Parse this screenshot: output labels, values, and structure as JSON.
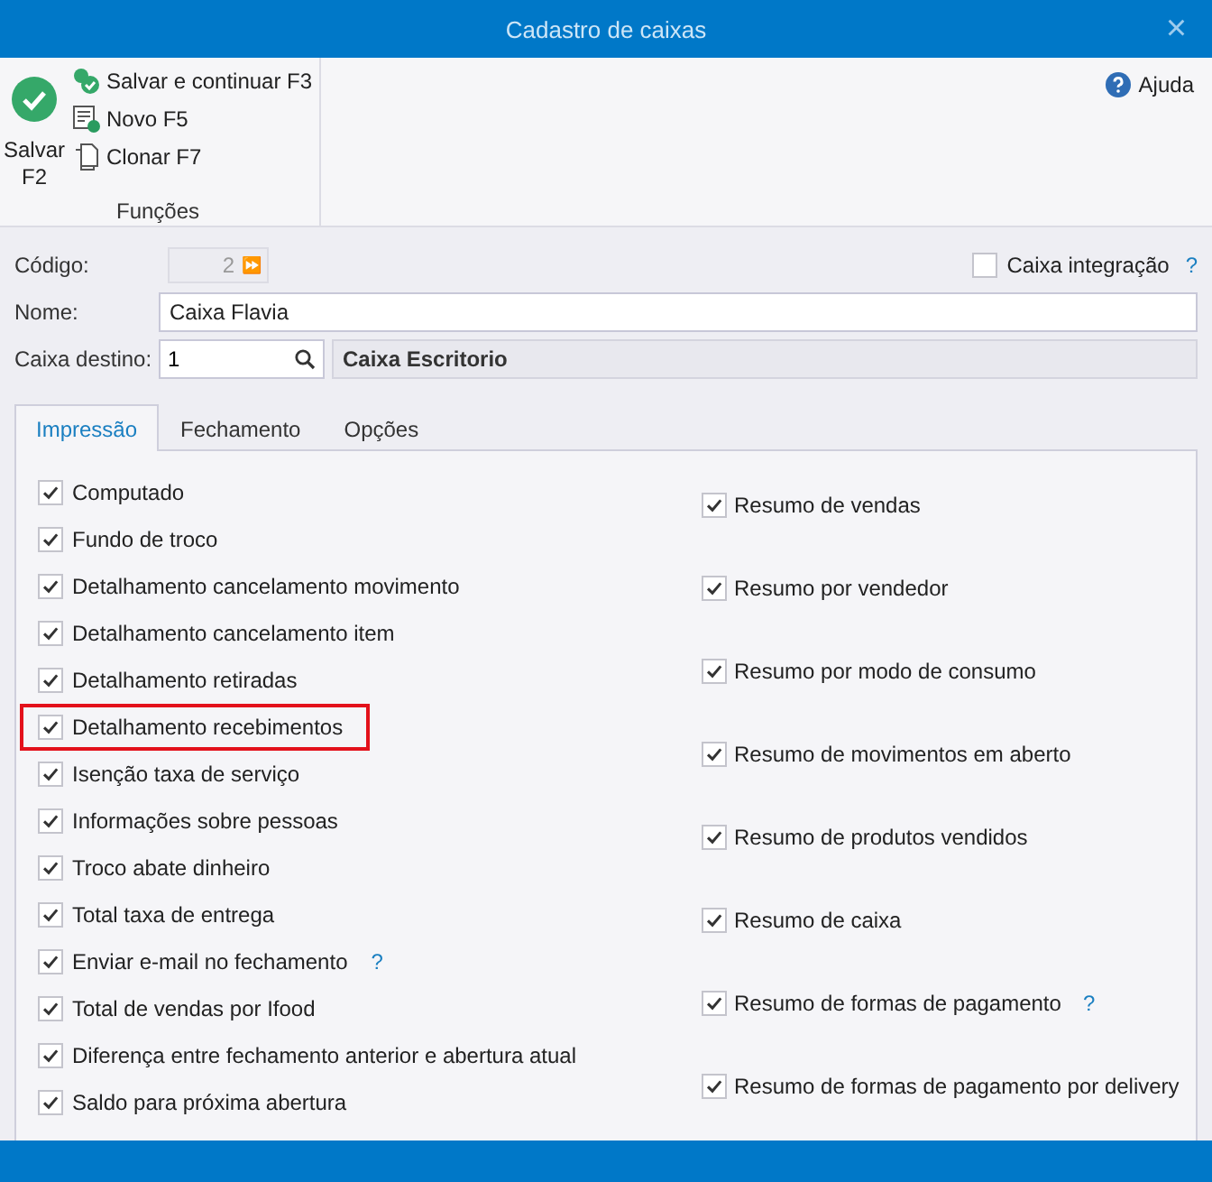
{
  "window": {
    "title": "Cadastro de caixas",
    "close": "×"
  },
  "ribbon": {
    "main": {
      "label": "Salvar F2"
    },
    "actions": [
      {
        "label": "Salvar e continuar F3",
        "kind": "save-continue"
      },
      {
        "label": "Novo F5",
        "kind": "new"
      },
      {
        "label": "Clonar F7",
        "kind": "clone"
      }
    ],
    "group_label": "Funções",
    "help": "Ajuda"
  },
  "form": {
    "codigo": {
      "label": "Código:",
      "value": "2",
      "arrow": "⏩"
    },
    "integracao": {
      "label": "Caixa integração",
      "checked": false,
      "help": "?"
    },
    "nome": {
      "label": "Nome:",
      "value": "Caixa Flavia"
    },
    "destino": {
      "label": "Caixa destino:",
      "value": "1",
      "description": "Caixa Escritorio"
    }
  },
  "tabs": [
    {
      "label": "Impressão",
      "selected": true
    },
    {
      "label": "Fechamento",
      "selected": false
    },
    {
      "label": "Opções",
      "selected": false
    }
  ],
  "left_options": [
    {
      "label": "Computado",
      "checked": true,
      "highlighted": false
    },
    {
      "label": "Fundo de troco",
      "checked": true,
      "highlighted": false
    },
    {
      "label": "Detalhamento cancelamento movimento",
      "checked": true,
      "highlighted": false
    },
    {
      "label": "Detalhamento cancelamento item",
      "checked": true,
      "highlighted": false
    },
    {
      "label": "Detalhamento retiradas",
      "checked": true,
      "highlighted": false
    },
    {
      "label": "Detalhamento recebimentos",
      "checked": true,
      "highlighted": true
    },
    {
      "label": "Isenção taxa de serviço",
      "checked": true,
      "highlighted": false
    },
    {
      "label": "Informações sobre pessoas",
      "checked": true,
      "highlighted": false
    },
    {
      "label": "Troco abate dinheiro",
      "checked": true,
      "highlighted": false
    },
    {
      "label": "Total taxa de entrega",
      "checked": true,
      "highlighted": false
    },
    {
      "label": "Enviar e-mail no fechamento",
      "checked": true,
      "highlighted": false,
      "help": "?"
    },
    {
      "label": "Total de vendas por Ifood",
      "checked": true,
      "highlighted": false
    },
    {
      "label": "Diferença entre fechamento anterior e abertura atual",
      "checked": true,
      "highlighted": false
    },
    {
      "label": "Saldo para próxima abertura",
      "checked": true,
      "highlighted": false
    }
  ],
  "right_options": [
    {
      "label": "Resumo de vendas",
      "checked": true
    },
    {
      "label": "Resumo por vendedor",
      "checked": true
    },
    {
      "label": "Resumo por modo de consumo",
      "checked": true
    },
    {
      "label": "Resumo de movimentos em aberto",
      "checked": true
    },
    {
      "label": "Resumo de produtos vendidos",
      "checked": true
    },
    {
      "label": "Resumo de caixa",
      "checked": true
    },
    {
      "label": "Resumo de formas de pagamento",
      "checked": true,
      "help": "?"
    },
    {
      "label": "Resumo de formas de pagamento por delivery",
      "checked": true
    }
  ]
}
